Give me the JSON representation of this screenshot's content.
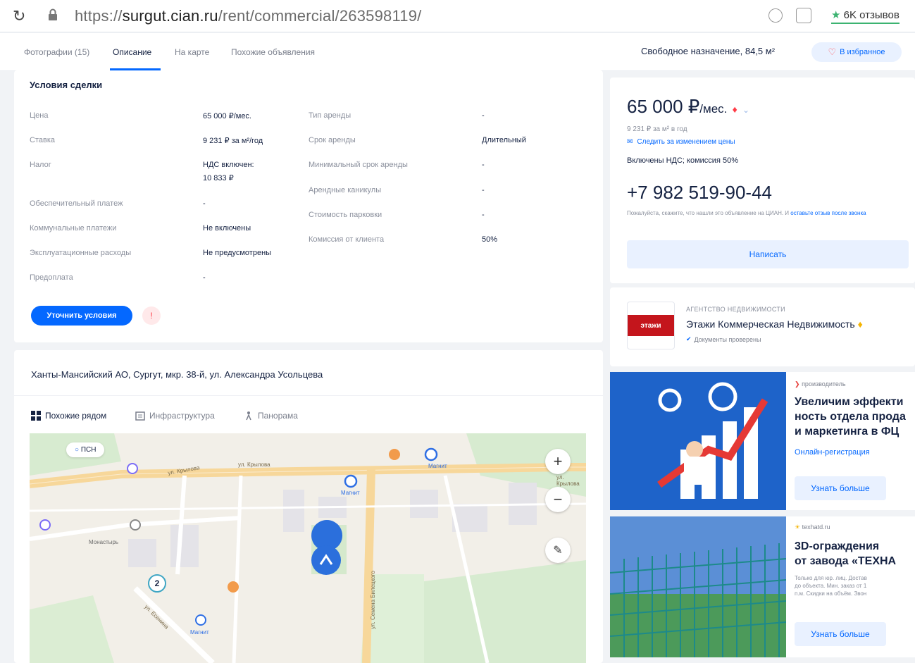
{
  "browser": {
    "url_prefix": "https://",
    "url_domain": "surgut.cian.ru",
    "url_path": "/rent/commercial/263598119/",
    "reviews_label": "6K отзывов"
  },
  "subnav": {
    "tabs": [
      {
        "label": "Фотографии (15)"
      },
      {
        "label": "Описание"
      },
      {
        "label": "На карте"
      },
      {
        "label": "Похожие объявления"
      }
    ],
    "purpose": "Свободное назначение, 84,5 м²",
    "favorite_label": "В избранное"
  },
  "terms": {
    "title": "Условия сделки",
    "left_rows": [
      {
        "label": "Цена",
        "value": "65 000 ₽/мес."
      },
      {
        "label": "Ставка",
        "value": "9 231 ₽ за м²/год"
      },
      {
        "label": "Налог",
        "value": "НДС включен:"
      },
      {
        "label": "Обеспечительный платеж",
        "value": "-"
      },
      {
        "label": "Коммунальные платежи",
        "value": "Не включены"
      },
      {
        "label": "Эксплуатационные расходы",
        "value": "Не предусмотрены"
      },
      {
        "label": "Предоплата",
        "value": "-"
      }
    ],
    "tax_amount": "10 833 ₽",
    "right_rows": [
      {
        "label": "Тип аренды",
        "value": "-"
      },
      {
        "label": "Срок аренды",
        "value": "Длительный"
      },
      {
        "label": "Минимальный срок аренды",
        "value": "-"
      },
      {
        "label": "Арендные каникулы",
        "value": "-"
      },
      {
        "label": "Стоимость парковки",
        "value": "-"
      },
      {
        "label": "Комиссия от клиента",
        "value": "50%"
      }
    ],
    "clarify_button": "Уточнить условия",
    "warn_icon": "!"
  },
  "map_section": {
    "address": "Ханты-Мансийский АО, Сургут, мкр. 38-й, ул. Александра Усольцева",
    "tabs": [
      {
        "label": "Похожие рядом"
      },
      {
        "label": "Инфраструктура"
      },
      {
        "label": "Панорама"
      }
    ],
    "labels": {
      "psn": "ПСН",
      "street1": "ул. Крылова",
      "street2": "ул. Крылова",
      "street3": "ул. Крылова",
      "street4": "ул. Семена Билецкого",
      "street5": "ул. Есенина",
      "magnit1": "Магнит",
      "magnit2": "Магнит",
      "magnit3": "Магнит",
      "mono": "Монастырь",
      "cluster": "2",
      "zoom_in": "+",
      "zoom_out": "−"
    }
  },
  "price_card": {
    "price": "65 000 ₽",
    "per": "/мес.",
    "rate": "9 231 ₽ за м² в год",
    "track_label": "Следить за изменением цены",
    "vat_info": "Включены НДС; комиссия 50%",
    "phone": "+7 982 519-90-44",
    "phone_note": "Пожалуйста, скажите, что нашли это объявление на ЦИАН. И",
    "phone_note_link": "оставьте отзыв после звонка",
    "write_button": "Написать"
  },
  "agency": {
    "logo_text": "этажи",
    "type": "АГЕНТСТВО НЕДВИЖИМОСТИ",
    "name": "Этажи Коммерческая Недвижимость",
    "docs": "Документы проверены"
  },
  "ads": [
    {
      "source": "производитель",
      "title_lines": [
        "Увеличим эффекти",
        "ность отдела прода",
        "и маркетинга в ФЦ"
      ],
      "link": "Онлайн-регистрация",
      "button": "Узнать больше"
    },
    {
      "source": "texhatd.ru",
      "title_lines": [
        "3D-ограждения",
        "от завода «ТЕХНА"
      ],
      "desc_lines": [
        "Только для юр. лиц. Достав",
        "до объекта. Мин. заказ от 1",
        "п.м. Скидки на объём. Звон"
      ],
      "button": "Узнать больше"
    }
  ],
  "colors": {
    "accent": "#0468ff",
    "text": "#152242",
    "muted": "#8a8f9c",
    "agency_red": "#c4151c",
    "road": "#f7d79a"
  }
}
